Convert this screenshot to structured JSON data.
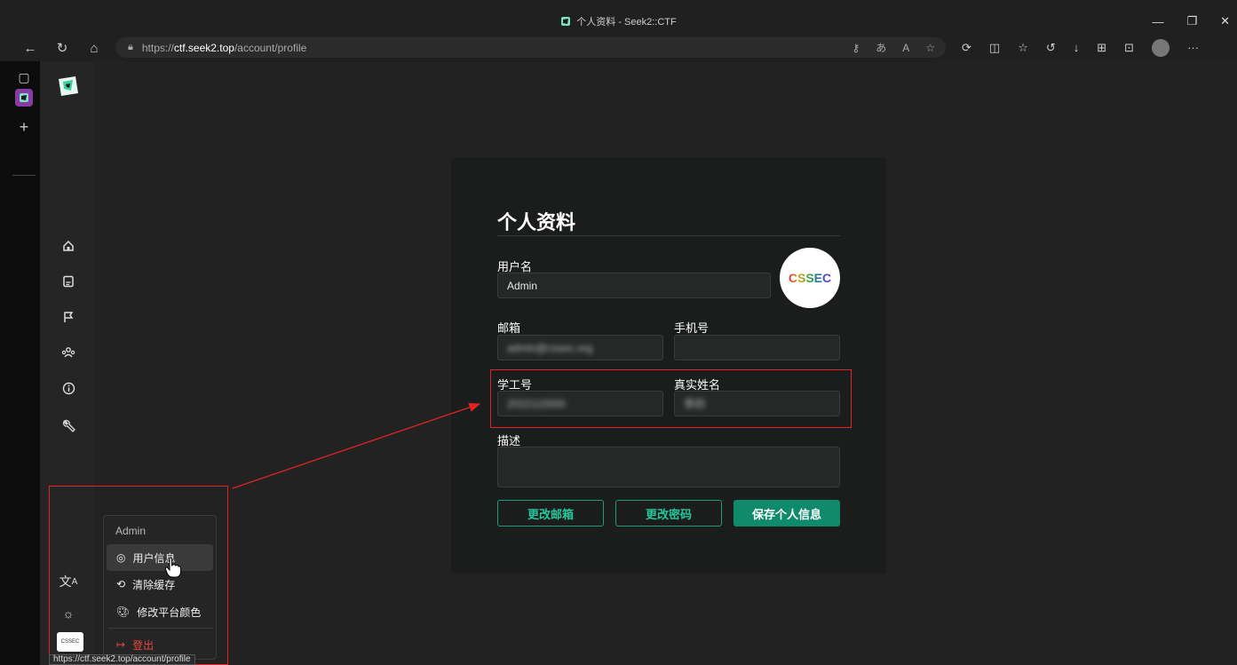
{
  "window": {
    "title": "个人资料 - Seek2::CTF"
  },
  "browser": {
    "url_prefix": "https://",
    "url_host": "ctf.seek2.top",
    "url_path": "/account/profile",
    "status_url": "https://ctf.seek2.top/account/profile"
  },
  "profile": {
    "title": "个人资料",
    "username_label": "用户名",
    "username_value": "Admin",
    "email_label": "邮箱",
    "email_value": "admin@cssec.org",
    "phone_label": "手机号",
    "phone_value": "",
    "student_id_label": "学工号",
    "student_id_value": "2022110000",
    "realname_label": "真实姓名",
    "realname_value": "李四",
    "desc_label": "描述",
    "desc_value": "",
    "avatar_text": "CSSEC",
    "btn_change_email": "更改邮箱",
    "btn_change_password": "更改密码",
    "btn_save": "保存个人信息"
  },
  "user_menu": {
    "header": "Admin",
    "items": [
      {
        "label": "用户信息",
        "icon": "user-circle-icon"
      },
      {
        "label": "清除缓存",
        "icon": "refresh-icon"
      },
      {
        "label": "修改平台颜色",
        "icon": "palette-icon"
      },
      {
        "label": "登出",
        "icon": "logout-icon"
      }
    ]
  },
  "sidebar_avatar_text": "CSSEC",
  "colors": {
    "accent": "#0f8a6a",
    "annotation": "#e02424",
    "danger": "#e5483e"
  }
}
